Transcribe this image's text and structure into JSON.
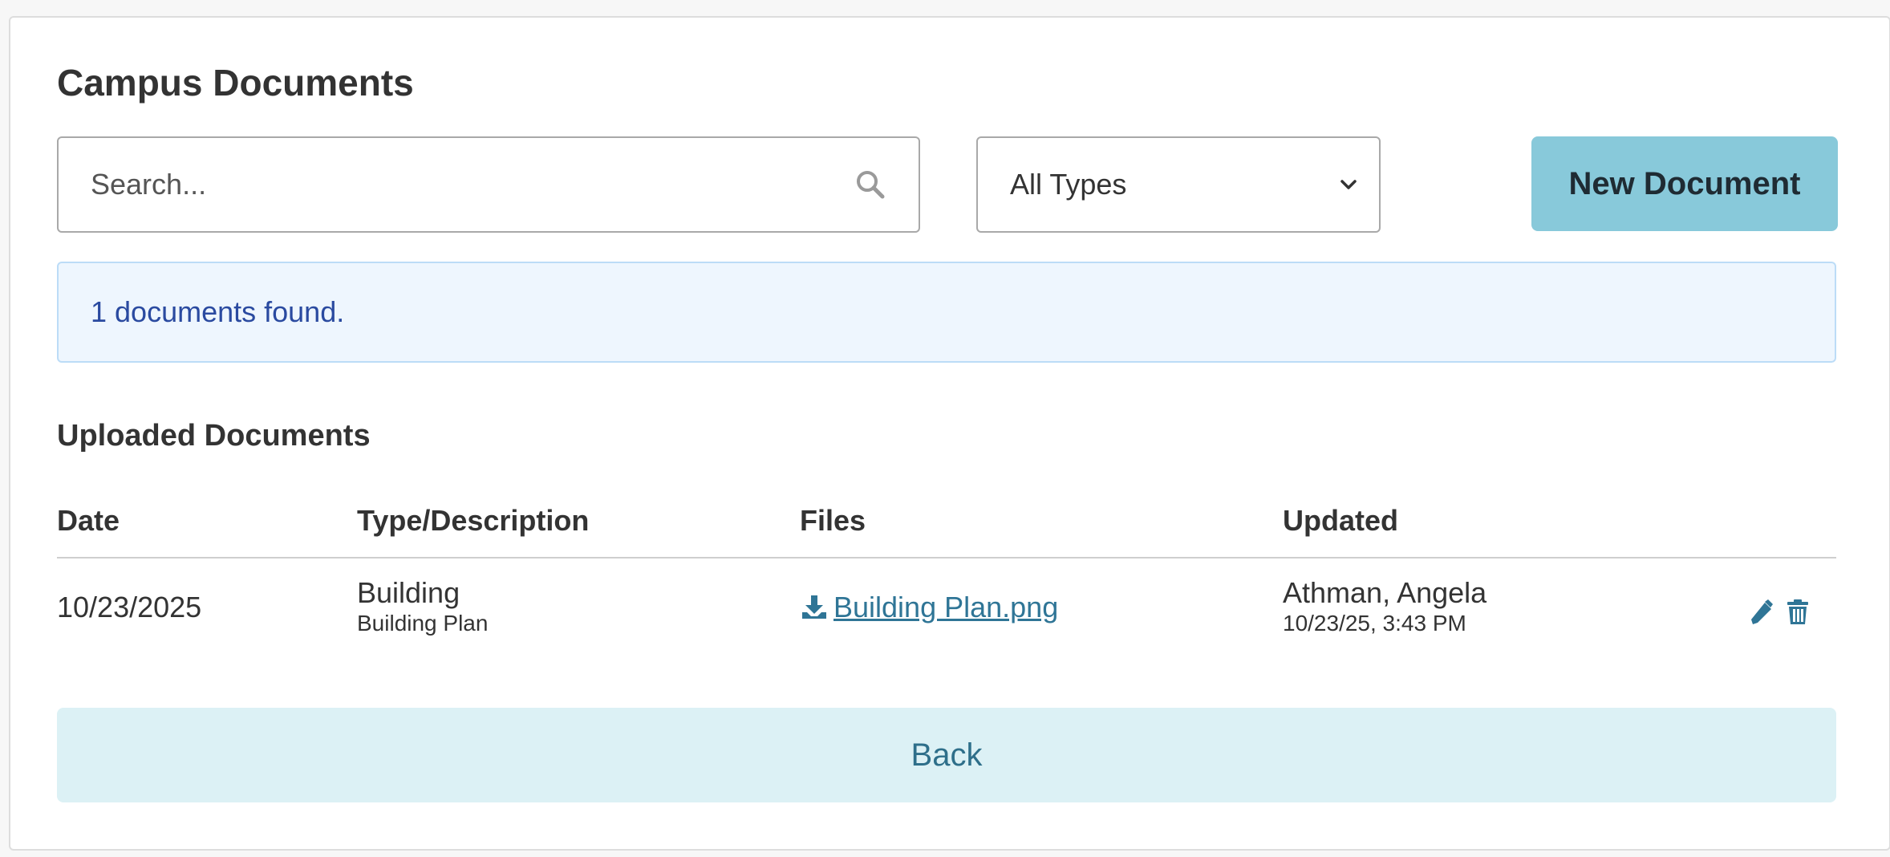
{
  "page": {
    "title": "Campus Documents"
  },
  "search": {
    "placeholder": "Search..."
  },
  "filter": {
    "selected": "All Types"
  },
  "toolbar": {
    "new_label": "New Document"
  },
  "alert": {
    "message": "1 documents found."
  },
  "section": {
    "title": "Uploaded Documents"
  },
  "table": {
    "headers": {
      "date": "Date",
      "type": "Type/Description",
      "files": "Files",
      "updated": "Updated"
    },
    "rows": [
      {
        "date": "10/23/2025",
        "type": "Building",
        "description": "Building Plan",
        "file": "Building Plan.png",
        "updated_by": "Athman, Angela",
        "updated_at": "10/23/25, 3:43 PM"
      }
    ]
  },
  "back": {
    "label": "Back"
  },
  "colors": {
    "accent": "#88c9da",
    "link": "#2f7596",
    "alert_bg": "#eef6fe",
    "alert_text": "#2a4aa0",
    "back_bg": "#dcf1f5"
  },
  "icons": {
    "search": "search-icon",
    "select": "chevron-down-icon",
    "download": "download-icon",
    "edit": "pencil-icon",
    "delete": "trash-icon"
  }
}
